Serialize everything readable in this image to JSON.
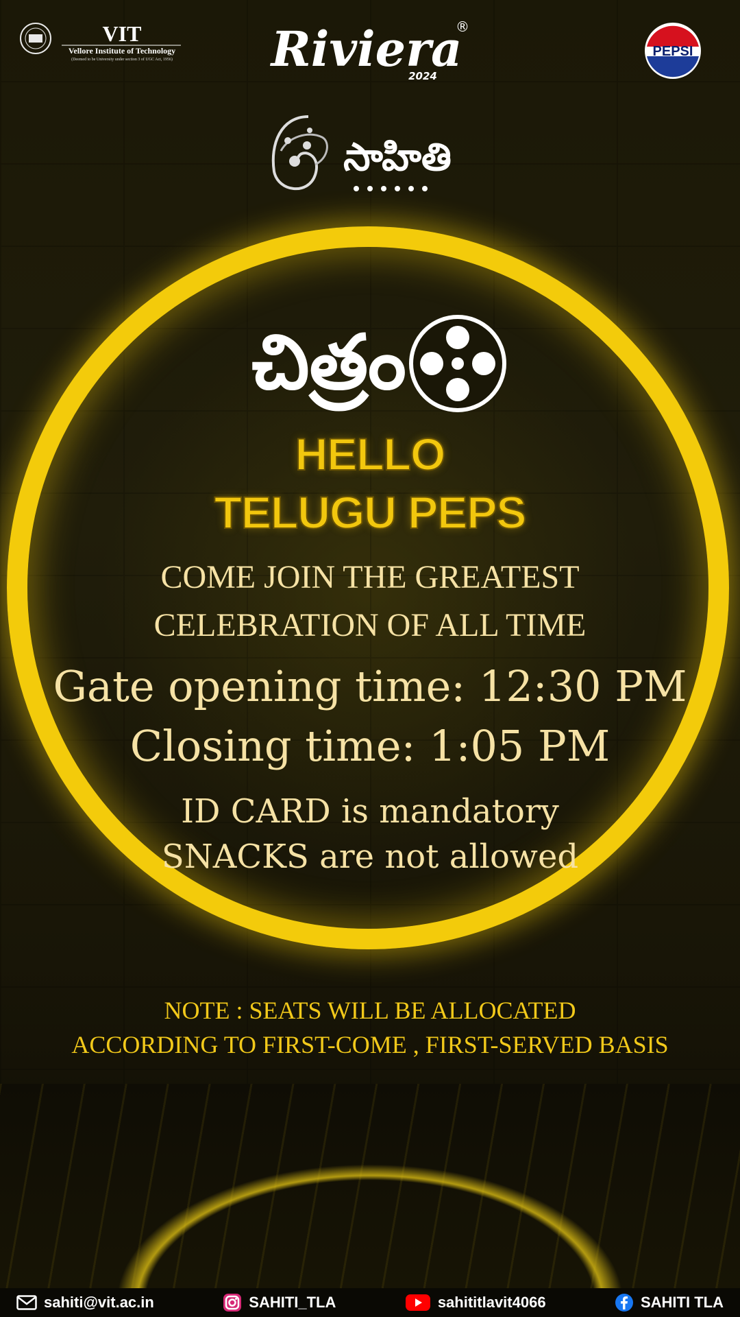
{
  "header": {
    "vit_logo": {
      "name": "VIT",
      "subtitle": "Vellore Institute of Technology",
      "note": "(Deemed to be University under section 3 of UGC Act, 1956)"
    },
    "riviera_logo": {
      "name": "Riviera",
      "year": "2024",
      "registered_mark": "®"
    },
    "pepsi_logo": {
      "name": "PEPSI"
    },
    "sahiti_logo": {
      "name": "సాహితి"
    }
  },
  "poster": {
    "title_telugu": "చిత్రం",
    "hello_line1": "HELLO",
    "hello_line2": "TELUGU PEPS",
    "come_line1": "COME JOIN THE GREATEST",
    "come_line2": "CELEBRATION OF ALL TIME",
    "gate_time": "Gate opening time: 12:30 PM",
    "closing_time": "Closing time: 1:05 PM",
    "id_rule": "ID CARD is mandatory",
    "snack_rule": "SNACKS are not allowed",
    "note_line1": "NOTE : SEATS WILL BE ALLOCATED",
    "note_line2": "ACCORDING TO FIRST-COME , FIRST-SERVED BASIS"
  },
  "footer": {
    "email": {
      "icon": "mail-icon",
      "text": "sahiti@vit.ac.in"
    },
    "instagram": {
      "icon": "instagram-icon",
      "text": "SAHITI_TLA"
    },
    "youtube": {
      "icon": "youtube-icon",
      "text": "sahititlavit4066"
    },
    "facebook": {
      "icon": "facebook-icon",
      "text": "SAHITI TLA"
    }
  },
  "colors": {
    "accent": "#f3cb0b",
    "text_cream": "#f6e2a5",
    "background": "#1b1807"
  }
}
